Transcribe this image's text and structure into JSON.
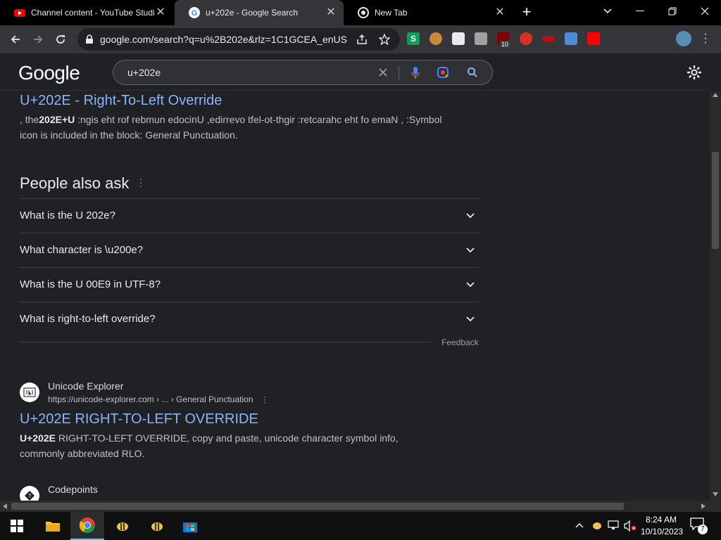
{
  "tabs": [
    {
      "title": "Channel content - YouTube Studio",
      "icon": "youtube-icon",
      "active": false
    },
    {
      "title": "u+202e - Google Search",
      "icon": "google-icon",
      "active": true
    },
    {
      "title": "New Tab",
      "icon": "chrome-icon",
      "active": false
    }
  ],
  "toolbar": {
    "url": "google.com/search?q=u%2B202e&rlz=1C1GCEA_enUS...",
    "ext_badge": "10"
  },
  "google": {
    "logo": "Google",
    "query": "u+202e"
  },
  "result1": {
    "title": "U+202E - Right-To-Left Override",
    "snippet_line1_pre": ", the",
    "snippet_bold": "202E+U",
    "snippet_line1_post": " :ngis eht rof rebmun edocinU ,edirrevo tfel-ot-thgir :retcarahc eht fo emaN , :Symbol",
    "snippet_line2": "icon is included in the block: General Punctuation."
  },
  "paa": {
    "heading": "People also ask",
    "questions": [
      "What is the U 202e?",
      "What character is \\u200e?",
      "What is the U 00E9 in UTF-8?",
      "What is right-to-left override?"
    ],
    "feedback": "Feedback"
  },
  "result2": {
    "site": "Unicode Explorer",
    "breadcrumb": "https://unicode-explorer.com › ... › General Punctuation",
    "title": "U+202E RIGHT-TO-LEFT OVERRIDE",
    "snippet_bold": "U+202E",
    "snippet_rest": " RIGHT-TO-LEFT OVERRIDE, copy and paste, unicode character symbol info,",
    "snippet_line2": "commonly abbreviated RLO."
  },
  "result3": {
    "site": "Codepoints"
  },
  "taskbar": {
    "time": "8:24 AM",
    "date": "10/10/2023",
    "notifications": "7"
  },
  "colors": {
    "link": "#8ab4f8",
    "background": "#202124",
    "text": "#e8eaed"
  }
}
